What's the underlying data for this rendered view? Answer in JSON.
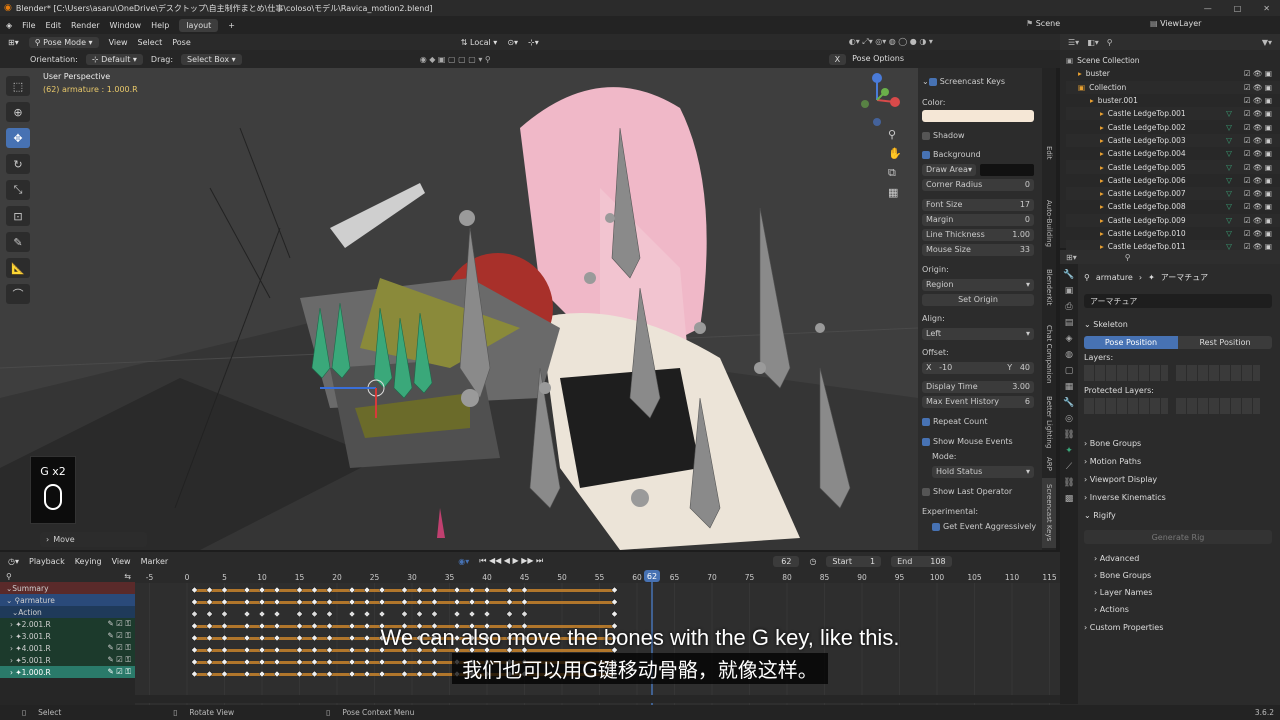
{
  "title_bar": {
    "text": "Blender* [C:\\Users\\asaru\\OneDrive\\デスクトップ\\自主制作まとめ\\仕事\\coloso\\モデル\\Ravica_motion2.blend]",
    "min": "—",
    "max": "□",
    "close": "✕"
  },
  "menubar": {
    "items": [
      "File",
      "Edit",
      "Render",
      "Window",
      "Help"
    ],
    "workspace_tab": "layout",
    "add_tab": "+",
    "scene_label": "Scene",
    "viewlayer_label": "ViewLayer"
  },
  "viewport_header": {
    "mode": "Pose Mode",
    "menus": [
      "View",
      "Select",
      "Pose"
    ],
    "transform": "Local",
    "orientation_label": "Orientation:",
    "orientation_value": "Default",
    "drag_label": "Drag:",
    "drag_value": "Select Box",
    "pose_options": "Pose Options",
    "x_btn": "X"
  },
  "viewport": {
    "perspective": "User Perspective",
    "object_info": "(62) armature : 1.000.R",
    "keycast_key": "G x2",
    "last_op": "Move"
  },
  "screencast": {
    "title": "Screencast Keys",
    "color_label": "Color:",
    "shadow_label": "Shadow",
    "background_label": "Background",
    "draw_area_label": "Draw Area",
    "corner_radius_label": "Corner Radius",
    "corner_radius": "0",
    "font_size_label": "Font Size",
    "font_size": "17",
    "margin_label": "Margin",
    "margin": "0",
    "line_thickness_label": "Line Thickness",
    "line_thickness": "1.00",
    "mouse_size_label": "Mouse Size",
    "mouse_size": "33",
    "origin_label": "Origin:",
    "origin_value": "Region",
    "set_origin": "Set Origin",
    "align_label": "Align:",
    "align_value": "Left",
    "offset_label": "Offset:",
    "offset_x_label": "X",
    "offset_x": "-10",
    "offset_y_label": "Y",
    "offset_y": "40",
    "display_time_label": "Display Time",
    "display_time": "3.00",
    "max_history_label": "Max Event History",
    "max_history": "6",
    "repeat_count_label": "Repeat Count",
    "show_mouse_label": "Show Mouse Events",
    "mode_label": "Mode:",
    "mode_value": "Hold Status",
    "show_last_op_label": "Show Last Operator",
    "experimental_label": "Experimental:",
    "get_event_label": "Get Event Aggressively"
  },
  "side_tabs": [
    "Screencast Keys",
    "ARP",
    "Better Lighting",
    "Chat Companion",
    "BlenderKit",
    "Auto-Building",
    "Edit"
  ],
  "outliner": {
    "scene_collection": "Scene Collection",
    "items": [
      "buster",
      "Collection",
      "buster.001",
      "Castle LedgeTop.001",
      "Castle LedgeTop.002",
      "Castle LedgeTop.003",
      "Castle LedgeTop.004",
      "Castle LedgeTop.005",
      "Castle LedgeTop.006",
      "Castle LedgeTop.007",
      "Castle LedgeTop.008",
      "Castle LedgeTop.009",
      "Castle LedgeTop.010",
      "Castle LedgeTop.011"
    ]
  },
  "properties": {
    "breadcrumb_obj": "armature",
    "breadcrumb_data": "アーマチュア",
    "data_name": "アーマチュア",
    "skeleton": "Skeleton",
    "pose_position": "Pose Position",
    "rest_position": "Rest Position",
    "layers": "Layers:",
    "protected_layers": "Protected Layers:",
    "sections": [
      "Bone Groups",
      "Motion Paths",
      "Viewport Display",
      "Inverse Kinematics",
      "Rigify"
    ],
    "generate_rig": "Generate Rig",
    "rigify_sub": [
      "Advanced",
      "Bone Groups",
      "Layer Names",
      "Actions"
    ],
    "custom_props": "Custom Properties"
  },
  "timeline": {
    "menus": [
      "Playback",
      "Keying",
      "View",
      "Marker"
    ],
    "current_frame": "62",
    "start_label": "Start",
    "start": "1",
    "end_label": "End",
    "end": "108",
    "ruler": [
      "-5",
      "0",
      "5",
      "10",
      "15",
      "20",
      "25",
      "30",
      "35",
      "40",
      "45",
      "50",
      "55",
      "60",
      "62",
      "65",
      "70",
      "75",
      "80",
      "85",
      "90",
      "95",
      "100",
      "105",
      "110",
      "115"
    ],
    "channels": [
      "Summary",
      "armature",
      "Action",
      "2.001.R",
      "3.001.R",
      "4.001.R",
      "5.001.R",
      "1.000.R"
    ]
  },
  "statusbar": {
    "items": [
      "Select",
      "Rotate View",
      "Pose Context Menu"
    ],
    "version": "3.6.2"
  },
  "subtitles": {
    "en": "We can also move the bones with the G key, like this.",
    "zh": "我们也可以用G键移动骨骼，就像这样。"
  },
  "colors": {
    "accent": "#4772b3",
    "keyframe_bar": "#c8822a",
    "playhead": "#4772b3",
    "bone_green": "#3aa87a",
    "hair_pink": "#f0b8c8"
  }
}
